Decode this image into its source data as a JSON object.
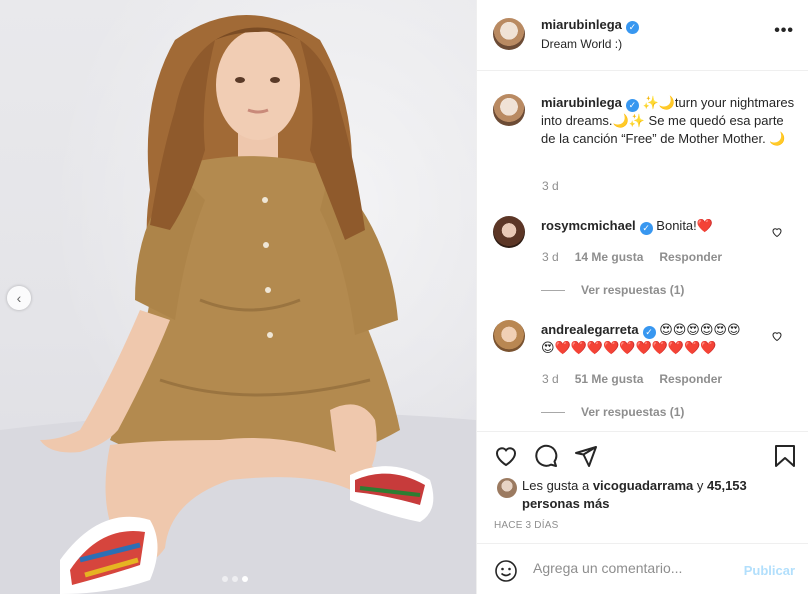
{
  "post": {
    "carousel": {
      "prev_icon": "chevron-left-icon",
      "dots": 3,
      "active_dot": 3
    }
  },
  "header": {
    "username": "miarubinlega",
    "verified": true,
    "subtitle": "Dream World :)",
    "more_label": "•••"
  },
  "caption": {
    "username": "miarubinlega",
    "text": "✨🌙turn your nightmares into dreams.🌙✨ Se me quedó esa parte de la canción “Free” de Mother Mother. 🌙",
    "time": "3 d"
  },
  "comments": [
    {
      "username": "rosymcmichael",
      "text": "Bonita!❤️",
      "time": "3 d",
      "likes": "14 Me gusta",
      "reply": "Responder",
      "view_replies": "Ver respuestas (1)"
    },
    {
      "username": "andrealegarreta",
      "text": "😍😍😍😍😍😍😍❤️❤️❤️❤️❤️❤️❤️❤️❤️❤️",
      "time": "3 d",
      "likes": "51 Me gusta",
      "reply": "Responder",
      "view_replies": "Ver respuestas (1)"
    }
  ],
  "actions": {
    "likes_prefix": "Les gusta a ",
    "likes_user": "vicoguadarrama",
    "likes_mid": " y ",
    "likes_count": "45,153 personas más",
    "timeago": "HACE 3 DÍAS"
  },
  "add_comment": {
    "placeholder": "Agrega un comentario...",
    "publish": "Publicar"
  },
  "colors": {
    "verified": "#3897f0",
    "publish_disabled": "#b2dffc",
    "muted": "#8e8e8e"
  }
}
